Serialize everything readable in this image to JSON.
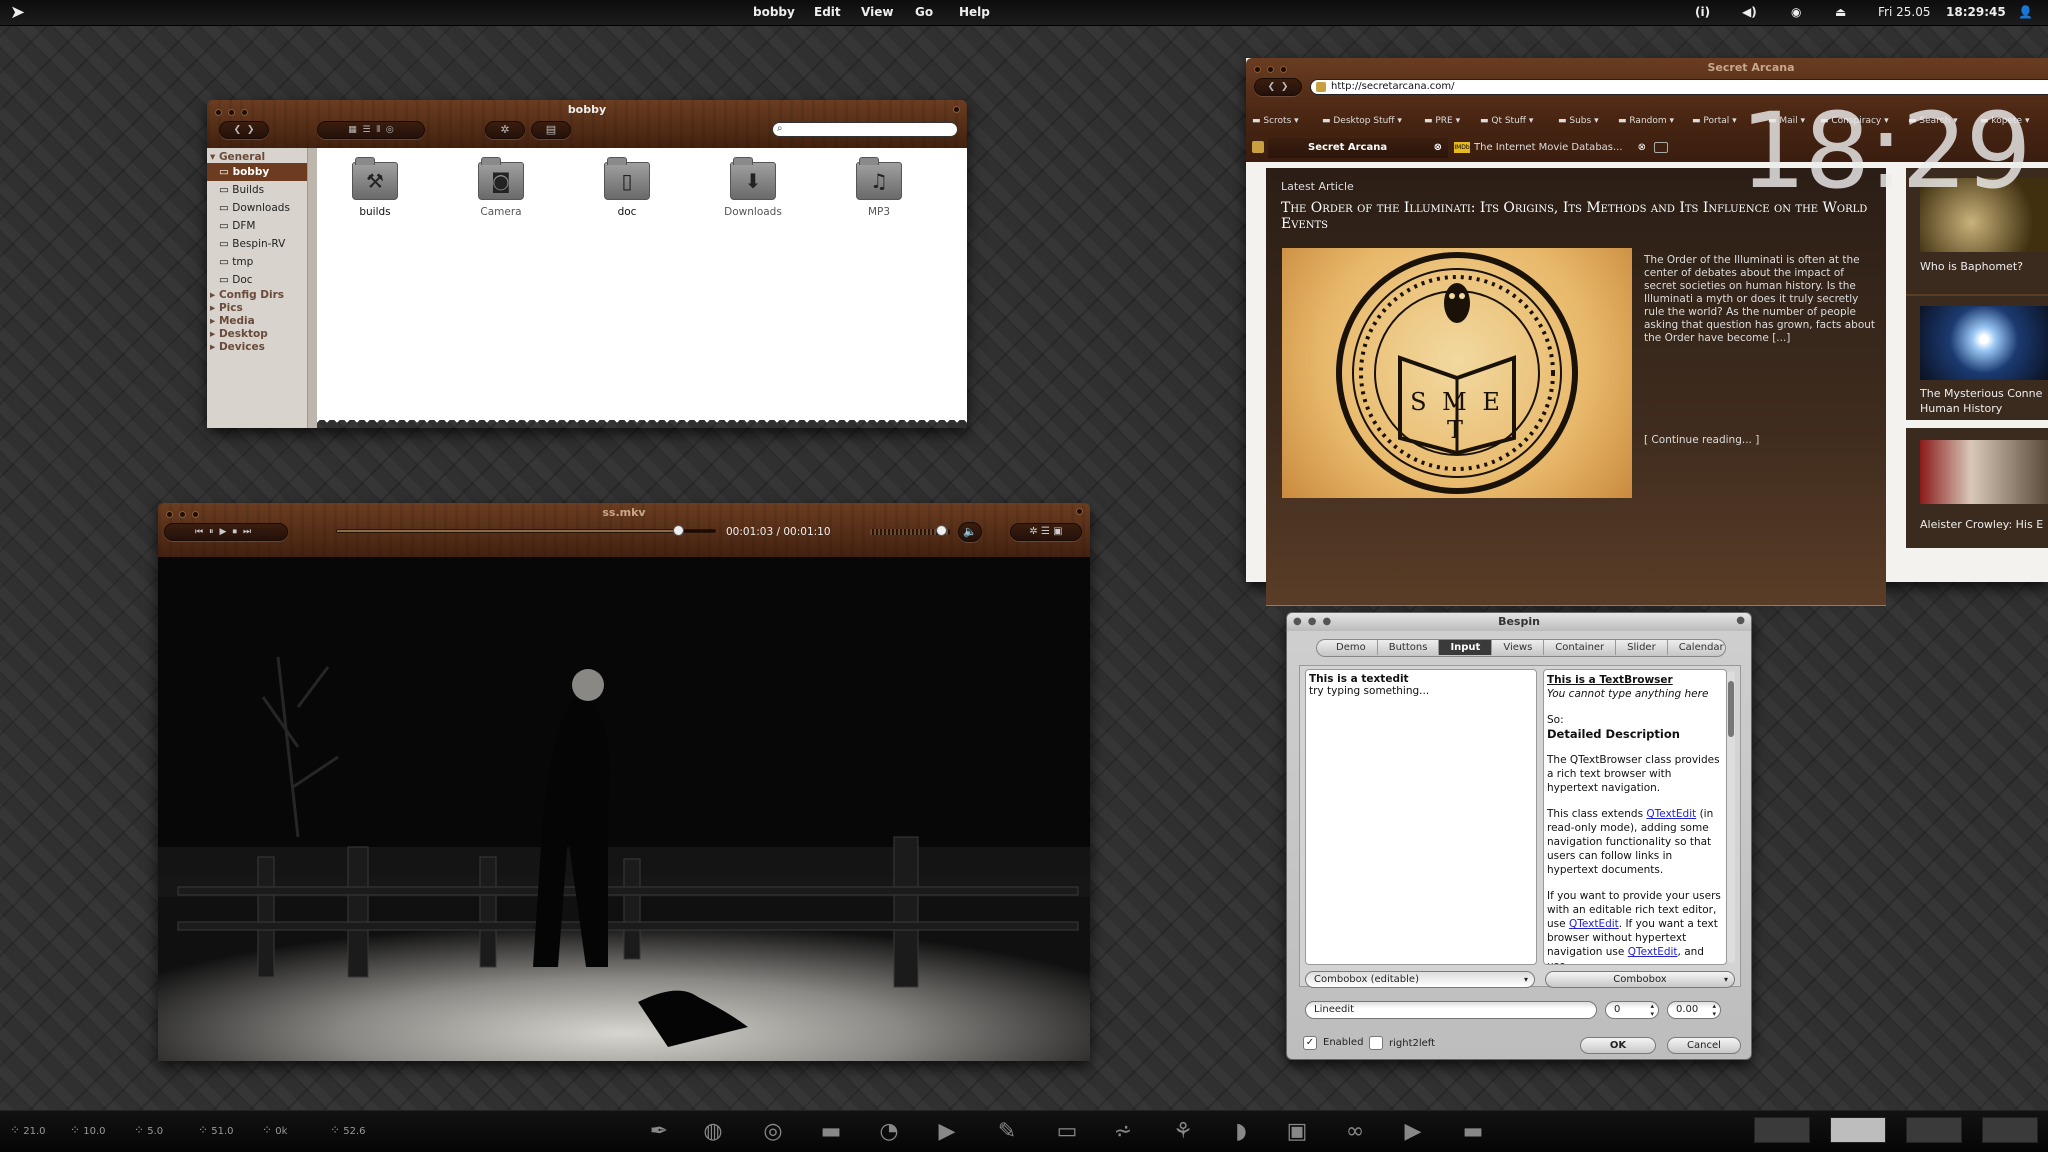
{
  "top_panel": {
    "app_menu": [
      "bobby",
      "Edit",
      "View",
      "Go",
      "Help"
    ],
    "date": "Fri 25.05",
    "time": "18:29:45",
    "tray_icons": [
      "info-icon",
      "volume-icon",
      "network-icon",
      "eject-icon",
      "user-icon"
    ]
  },
  "file_manager": {
    "title": "bobby",
    "sidebar": {
      "general_label": "General",
      "places": [
        "bobby",
        "Builds",
        "Downloads",
        "DFM",
        "Bespin-RV",
        "tmp",
        "Doc"
      ],
      "groups": [
        "Config Dirs",
        "Pics",
        "Media",
        "Desktop",
        "Devices"
      ]
    },
    "items": [
      {
        "name": "builds",
        "icon": "tools-icon"
      },
      {
        "name": "Camera",
        "icon": "camera-icon"
      },
      {
        "name": "doc",
        "icon": "document-icon"
      },
      {
        "name": "Downloads",
        "icon": "download-icon"
      },
      {
        "name": "MP3",
        "icon": "music-icon"
      }
    ]
  },
  "browser": {
    "title": "Secret Arcana",
    "url": "http://secretarcana.com/",
    "bookmarks": [
      "Scrots",
      "Desktop Stuff",
      "PRE",
      "Qt Stuff",
      "Subs",
      "Random",
      "Portal",
      "Mail",
      "Conspiracy",
      "Search",
      "kopete"
    ],
    "tabs": [
      "Secret Arcana",
      "The Internet Movie Databas..."
    ],
    "article": {
      "section": "Latest Article",
      "headline": "The Order of the Illuminati: Its Origins, Its Methods and Its Influence on the World Events",
      "excerpt": "The Order of the Illuminati is often at the center of debates about the impact of secret societies on human history. Is the Illuminati a myth or does it truly secretly rule the world? As the number of people asking that question has grown, facts about the Order have become [...]",
      "continue": "[ Continue reading... ]",
      "seal_letters": "S M E T"
    },
    "side_articles": [
      "Who is Baphomet?",
      "The Mysterious Conne Human History",
      "Aleister Crowley: His E"
    ]
  },
  "clock_overlay": "18:29",
  "media_player": {
    "title": "ss.mkv",
    "time": "00:01:03 / 00:01:10",
    "progress": 0.9,
    "volume": 0.9
  },
  "bespin": {
    "title": "Bespin",
    "tabs": [
      "Demo",
      "Buttons",
      "Input",
      "Views",
      "Container",
      "Slider",
      "Calendar"
    ],
    "active_tab": "Input",
    "textedit_title": "This is a textedit",
    "textedit_body": "try typing something...",
    "tb_title": "This is a TextBrowser",
    "tb_subtitle": "You cannot type anything here",
    "tb_so": "So:",
    "tb_heading": "Detailed Description",
    "tb_p1": "The QTextBrowser class provides a rich text browser with hypertext navigation.",
    "tb_p2a": "This class extends ",
    "tb_link1": "QTextEdit",
    "tb_p2b": " (in read-only mode), adding some navigation functionality so that users can follow links in hypertext documents.",
    "tb_p3a": "If you want to provide your users with an editable rich text editor, use ",
    "tb_link2": "QTextEdit",
    "tb_p3b": ". If you want a text browser without hypertext navigation use ",
    "tb_link3": "QTextEdit",
    "tb_p3c": ", and use",
    "combo_editable": "Combobox (editable)",
    "combo": "Combobox",
    "lineedit": "Lineedit",
    "spin_int": "0",
    "spin_double": "0.00",
    "check_enabled": "Enabled",
    "check_rtl": "right2left",
    "ok": "OK",
    "cancel": "Cancel"
  },
  "sysmon": [
    "21.0",
    "10.0",
    "5.0",
    "51.0",
    "0k",
    "52.6"
  ]
}
